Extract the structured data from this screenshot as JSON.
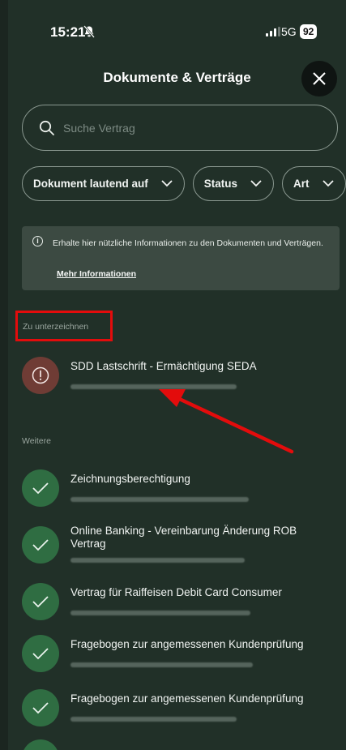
{
  "status_bar": {
    "time": "15:21",
    "network": "5G",
    "battery": "92"
  },
  "header": {
    "title": "Dokumente & Verträge"
  },
  "search": {
    "placeholder": "Suche Vertrag"
  },
  "filters": [
    {
      "label": "Dokument lautend auf"
    },
    {
      "label": "Status"
    },
    {
      "label": "Art"
    }
  ],
  "info": {
    "text": "Erhalte hier nützliche Informationen zu den Dokumenten und Verträgen.",
    "link": "Mehr Informationen"
  },
  "sections": {
    "to_sign": {
      "heading": "Zu unterzeichnen",
      "items": [
        {
          "title": "SDD Lastschrift - Ermächtigung SEDA",
          "status": "pending"
        }
      ]
    },
    "other": {
      "heading": "Weitere",
      "items": [
        {
          "title": "Zeichnungsberechtigung",
          "status": "signed"
        },
        {
          "title": "Online Banking - Vereinbarung Änderung ROB Vertrag",
          "status": "signed"
        },
        {
          "title": "Vertrag für Raiffeisen Debit Card Consumer",
          "status": "signed"
        },
        {
          "title": "Fragebogen zur angemessenen Kundenprüfung",
          "status": "signed"
        },
        {
          "title": "Fragebogen zur angemessenen Kundenprüfung",
          "status": "signed"
        }
      ]
    }
  },
  "colors": {
    "highlight": "#e30c0c",
    "signed": "#2f6d42",
    "pending": "#6f3c35",
    "background": "#213028"
  }
}
